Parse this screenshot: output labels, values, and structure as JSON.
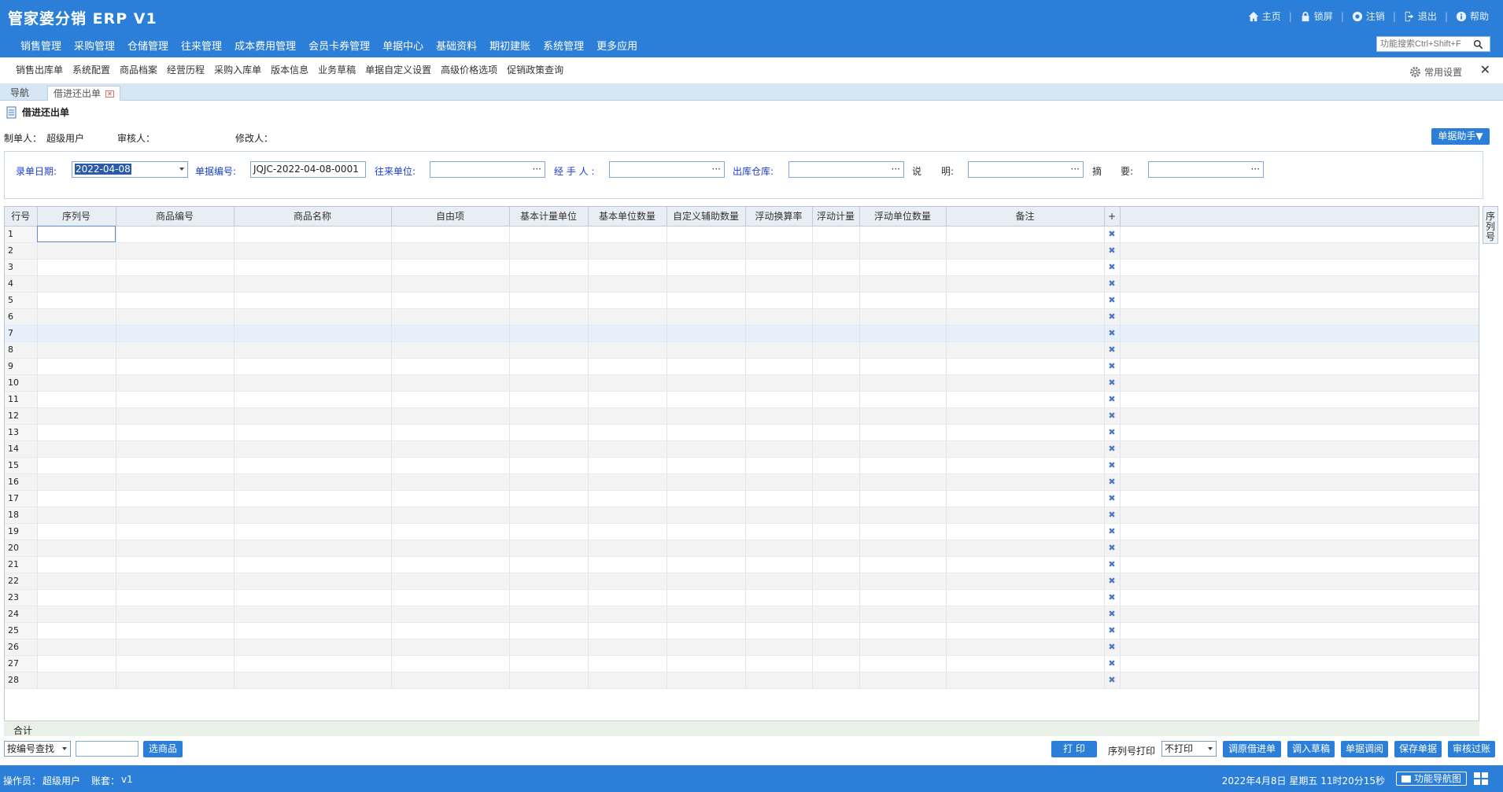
{
  "app": {
    "title": "管家婆分销 ERP V1"
  },
  "top_links": [
    {
      "label": "主页",
      "icon": "home-icon"
    },
    {
      "label": "锁屏",
      "icon": "lock-icon"
    },
    {
      "label": "注销",
      "icon": "logout-icon"
    },
    {
      "label": "退出",
      "icon": "exit-icon"
    },
    {
      "label": "帮助",
      "icon": "help-icon"
    }
  ],
  "main_menu": [
    "销售管理",
    "采购管理",
    "仓储管理",
    "往来管理",
    "成本费用管理",
    "会员卡券管理",
    "单据中心",
    "基础资料",
    "期初建账",
    "系统管理",
    "更多应用"
  ],
  "search": {
    "placeholder": "功能搜索Ctrl+Shift+F"
  },
  "quick_links": [
    "销售出库单",
    "系统配置",
    "商品档案",
    "经营历程",
    "采购入库单",
    "版本信息",
    "业务草稿",
    "单据自定义设置",
    "高级价格选项",
    "促销政策查询"
  ],
  "common_settings": "常用设置",
  "close_symbol": "✕",
  "tabs": {
    "nav": "导航",
    "doc": "借进还出单",
    "close": "✕"
  },
  "doc": {
    "title": "借进还出单"
  },
  "meta": {
    "creator_label": "制单人：",
    "creator": "超级用户",
    "auditor_label": "审核人：",
    "auditor": "",
    "modifier_label": "修改人：",
    "modifier": ""
  },
  "helper_button": "单据助手▼",
  "form": {
    "date_label": "录单日期:",
    "date_value": "2022-04-08",
    "number_label": "单据编号:",
    "number_value": "JQJC-2022-04-08-0001",
    "partner_label": "往来单位:",
    "partner_value": "",
    "handler_label": "经 手 人 :",
    "handler_value": "",
    "warehouse_label": "出库仓库:",
    "warehouse_value": "",
    "desc_label1": "说",
    "desc_label2": "明:",
    "desc_value": "",
    "summary_label1": "摘",
    "summary_label2": "要:",
    "summary_value": "",
    "dots": "···"
  },
  "grid": {
    "columns": [
      "行号",
      "序列号",
      "商品编号",
      "商品名称",
      "自由项",
      "基本计量单位",
      "基本单位数量",
      "自定义辅助数量",
      "浮动换算率",
      "浮动计量",
      "浮动单位数量",
      "备注",
      "+",
      ""
    ],
    "row_count": 28,
    "highlight_row": 7,
    "delete_symbol": "✖",
    "sum_label": "合计",
    "side_tab": "序列号"
  },
  "bottom": {
    "search_mode": "按编号查找",
    "select_goods": "选商品",
    "print": "打 印",
    "serial_print_label": "序列号打印",
    "serial_print_value": "不打印",
    "buttons": [
      "调原借进单",
      "调入草稿",
      "单据调阅",
      "保存单据",
      "审核过账"
    ]
  },
  "status": {
    "operator_label": "操作员：",
    "operator": "超级用户",
    "account_label": "账套：",
    "account": "v1",
    "datetime": "2022年4月8日 星期五 11时20分15秒",
    "nav_button": "功能导航图"
  },
  "colors": {
    "primary": "#2b7fd9",
    "label_blue": "#1a3fd1"
  }
}
